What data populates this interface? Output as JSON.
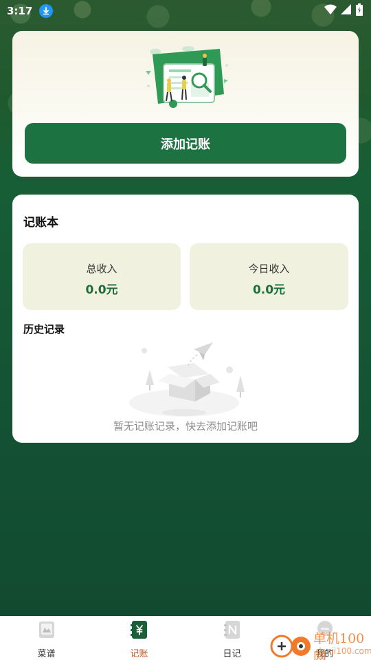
{
  "status_bar": {
    "time": "3:17",
    "icons": [
      "download-icon",
      "wifi-icon",
      "signal-icon",
      "battery-icon"
    ]
  },
  "top_card": {
    "add_button_label": "添加记账"
  },
  "ledger": {
    "title": "记账本",
    "total_income_label": "总收入",
    "total_income_value": "0.0元",
    "today_income_label": "今日收入",
    "today_income_value": "0.0元",
    "history_title": "历史记录",
    "empty_text": "暂无记账记录，快去添加记账吧"
  },
  "bottom_nav": {
    "items": [
      {
        "label": "菜谱",
        "icon": "recipe-book-icon",
        "active": false
      },
      {
        "label": "记账",
        "icon": "ledger-yen-icon",
        "active": true
      },
      {
        "label": "日记",
        "icon": "diary-notebook-icon",
        "active": false
      },
      {
        "label": "我的",
        "icon": "profile-icon",
        "active": false
      }
    ]
  },
  "watermark": {
    "brand": "单机100网",
    "site": "danji100.com"
  },
  "colors": {
    "primary_green": "#1c7240",
    "active_nav": "#c9541a",
    "stat_value": "#1c6e3b",
    "stat_box_bg": "#f1f1e0"
  }
}
